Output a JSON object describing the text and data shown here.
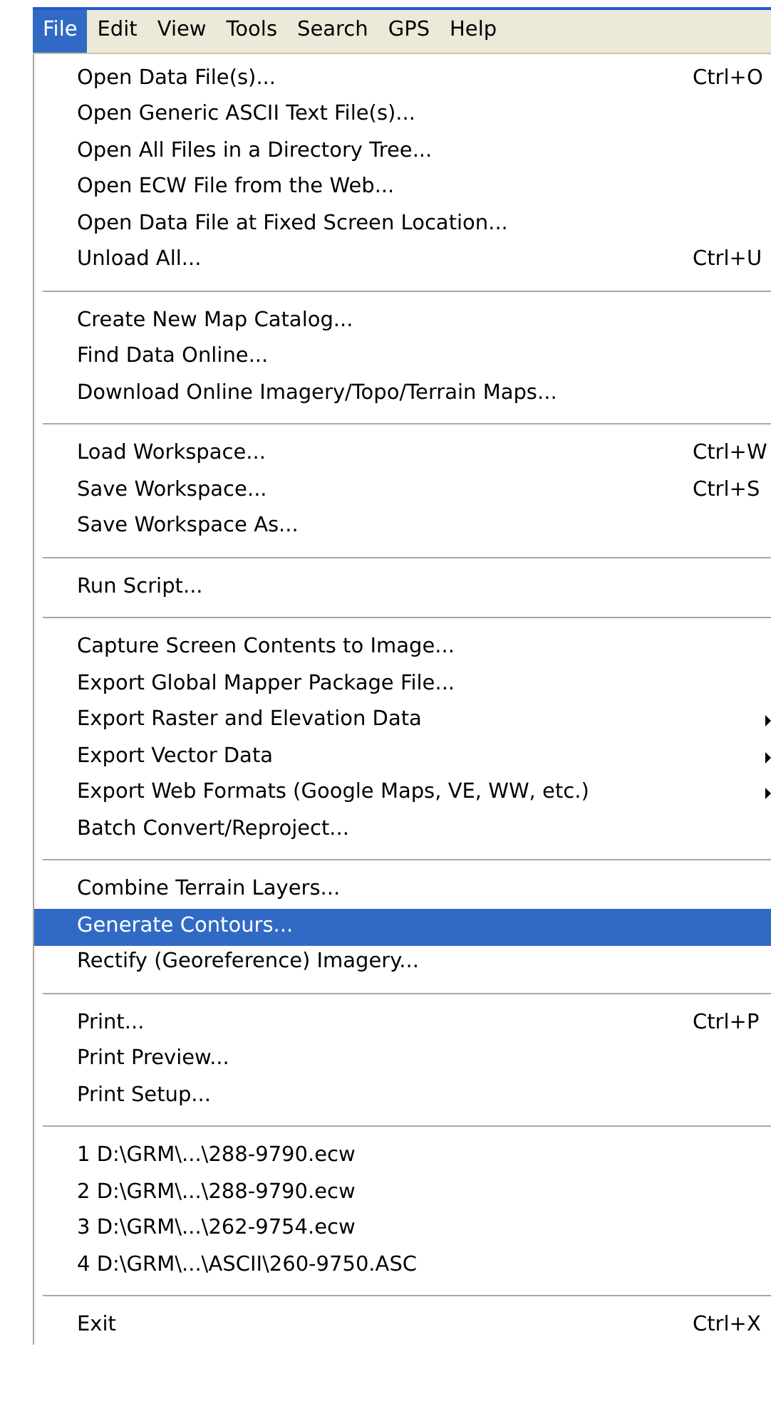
{
  "menu_bar": [
    {
      "label": "File",
      "selected": true
    },
    {
      "label": "Edit",
      "selected": false
    },
    {
      "label": "View",
      "selected": false
    },
    {
      "label": "Tools",
      "selected": false
    },
    {
      "label": "Search",
      "selected": false
    },
    {
      "label": "GPS",
      "selected": false
    },
    {
      "label": "Help",
      "selected": false
    }
  ],
  "file_menu": [
    {
      "kind": "item",
      "label": "Open Data File(s)...",
      "shortcut": "Ctrl+O",
      "submenu": false,
      "selected": false
    },
    {
      "kind": "item",
      "label": "Open Generic ASCII Text File(s)...",
      "submenu": false,
      "selected": false
    },
    {
      "kind": "item",
      "label": "Open All Files in a Directory Tree...",
      "submenu": false,
      "selected": false
    },
    {
      "kind": "item",
      "label": "Open ECW File from the Web...",
      "submenu": false,
      "selected": false
    },
    {
      "kind": "item",
      "label": "Open Data File at Fixed Screen Location...",
      "submenu": false,
      "selected": false
    },
    {
      "kind": "item",
      "label": "Unload All...",
      "shortcut": "Ctrl+U",
      "submenu": false,
      "selected": false
    },
    {
      "kind": "separator"
    },
    {
      "kind": "item",
      "label": "Create New Map Catalog...",
      "submenu": false,
      "selected": false
    },
    {
      "kind": "item",
      "label": "Find Data Online...",
      "submenu": false,
      "selected": false
    },
    {
      "kind": "item",
      "label": "Download Online Imagery/Topo/Terrain Maps...",
      "submenu": false,
      "selected": false
    },
    {
      "kind": "separator"
    },
    {
      "kind": "item",
      "label": "Load Workspace...",
      "shortcut": "Ctrl+W",
      "submenu": false,
      "selected": false
    },
    {
      "kind": "item",
      "label": "Save Workspace...",
      "shortcut": "Ctrl+S",
      "submenu": false,
      "selected": false
    },
    {
      "kind": "item",
      "label": "Save Workspace As...",
      "submenu": false,
      "selected": false
    },
    {
      "kind": "separator"
    },
    {
      "kind": "item",
      "label": "Run Script...",
      "submenu": false,
      "selected": false
    },
    {
      "kind": "separator"
    },
    {
      "kind": "item",
      "label": "Capture Screen Contents to Image...",
      "submenu": false,
      "selected": false
    },
    {
      "kind": "item",
      "label": "Export Global Mapper Package File...",
      "submenu": false,
      "selected": false
    },
    {
      "kind": "item",
      "label": "Export Raster and Elevation Data",
      "submenu": true,
      "selected": false
    },
    {
      "kind": "item",
      "label": "Export Vector Data",
      "submenu": true,
      "selected": false
    },
    {
      "kind": "item",
      "label": "Export Web Formats (Google Maps, VE, WW, etc.)",
      "submenu": true,
      "selected": false
    },
    {
      "kind": "item",
      "label": "Batch Convert/Reproject...",
      "submenu": false,
      "selected": false
    },
    {
      "kind": "separator"
    },
    {
      "kind": "item",
      "label": "Combine Terrain Layers...",
      "submenu": false,
      "selected": false
    },
    {
      "kind": "item",
      "label": "Generate Contours...",
      "submenu": false,
      "selected": true
    },
    {
      "kind": "item",
      "label": "Rectify (Georeference) Imagery...",
      "submenu": false,
      "selected": false
    },
    {
      "kind": "separator"
    },
    {
      "kind": "item",
      "label": "Print...",
      "shortcut": "Ctrl+P",
      "submenu": false,
      "selected": false
    },
    {
      "kind": "item",
      "label": "Print Preview...",
      "submenu": false,
      "selected": false
    },
    {
      "kind": "item",
      "label": "Print Setup...",
      "submenu": false,
      "selected": false
    },
    {
      "kind": "separator"
    },
    {
      "kind": "item",
      "label": "1 D:\\GRM\\...\\288-9790.ecw",
      "submenu": false,
      "selected": false
    },
    {
      "kind": "item",
      "label": "2 D:\\GRM\\...\\288-9790.ecw",
      "submenu": false,
      "selected": false
    },
    {
      "kind": "item",
      "label": "3 D:\\GRM\\...\\262-9754.ecw",
      "submenu": false,
      "selected": false
    },
    {
      "kind": "item",
      "label": "4 D:\\GRM\\...\\ASCII\\260-9750.ASC",
      "submenu": false,
      "selected": false
    },
    {
      "kind": "separator"
    },
    {
      "kind": "item",
      "label": "Exit",
      "shortcut": "Ctrl+X",
      "submenu": false,
      "selected": false
    }
  ]
}
